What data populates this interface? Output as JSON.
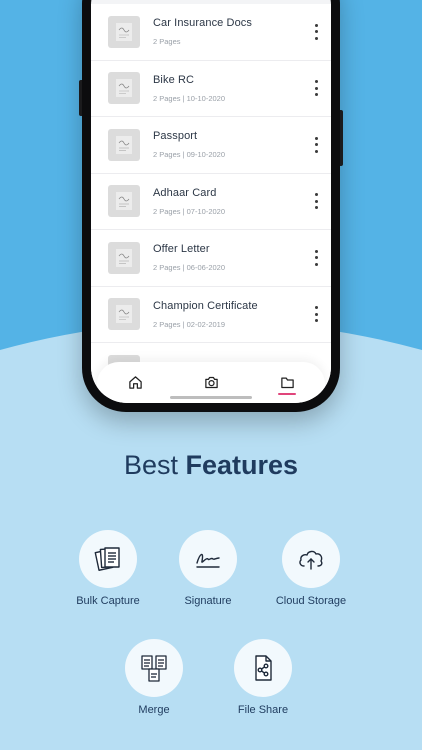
{
  "documents": [
    {
      "title": "Car Insurance Docs",
      "meta": "2 Pages"
    },
    {
      "title": "Bike RC",
      "meta": "2 Pages | 10-10-2020"
    },
    {
      "title": "Passport",
      "meta": "2 Pages | 09-10-2020"
    },
    {
      "title": "Adhaar Card",
      "meta": "2 Pages | 07-10-2020"
    },
    {
      "title": "Offer Letter",
      "meta": "2 Pages | 06-06-2020"
    },
    {
      "title": "Champion Certificate",
      "meta": "2 Pages | 02-02-2019"
    }
  ],
  "nav": {
    "items": [
      "home-icon",
      "camera-icon",
      "folder-icon"
    ],
    "active": "folder-icon",
    "accent": "#e0457b"
  },
  "headline": {
    "light": "Best",
    "bold": "Features"
  },
  "features": [
    {
      "label": "Bulk Capture",
      "icon": "bulk-capture-icon"
    },
    {
      "label": "Signature",
      "icon": "signature-icon"
    },
    {
      "label": "Cloud Storage",
      "icon": "cloud-upload-icon"
    },
    {
      "label": "Merge",
      "icon": "merge-icon"
    },
    {
      "label": "File Share",
      "icon": "file-share-icon"
    }
  ],
  "colors": {
    "background_top": "#54b3e6",
    "background_bottom": "#b7def3",
    "heading": "#1f3b5e"
  }
}
